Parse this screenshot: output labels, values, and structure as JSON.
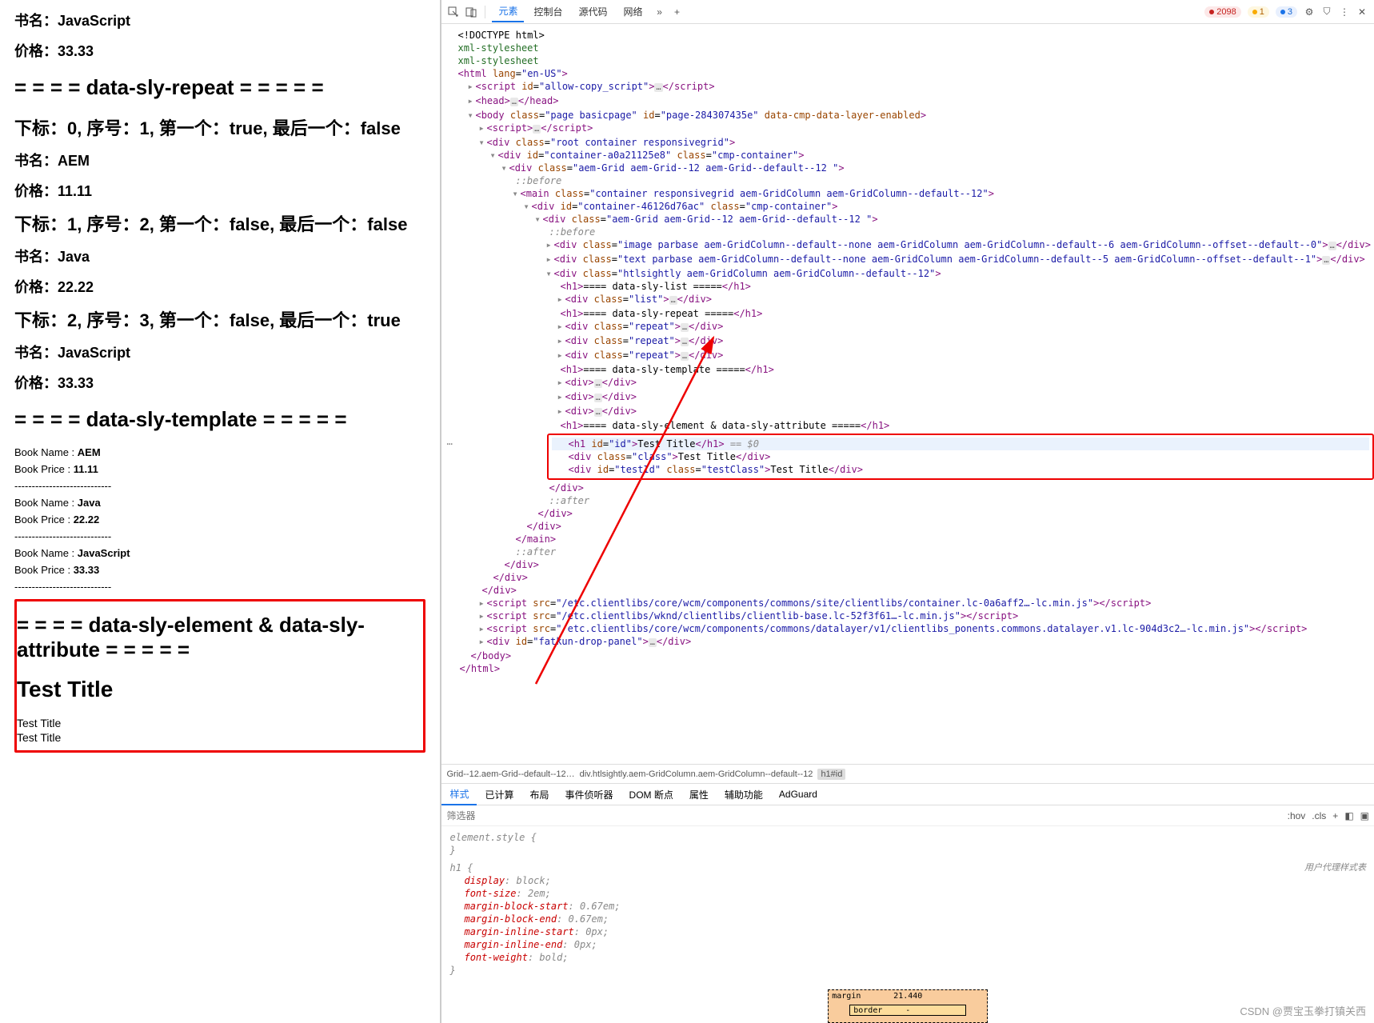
{
  "content": {
    "book1": {
      "name_label": "书名：",
      "name": "JavaScript",
      "price_label": "价格：",
      "price": "33.33"
    },
    "sec_repeat": "= = = = data-sly-repeat = = = = =",
    "rep": [
      {
        "stat": "下标：0, 序号：1, 第一个：true, 最后一个：false",
        "name": "AEM",
        "price": "11.11"
      },
      {
        "stat": "下标：1, 序号：2, 第一个：false, 最后一个：false",
        "name": "Java",
        "price": "22.22"
      },
      {
        "stat": "下标：2, 序号：3, 第一个：false, 最后一个：true",
        "name": "JavaScript",
        "price": "33.33"
      }
    ],
    "name_label": "书名：",
    "price_label": "价格：",
    "sec_template": "= = = = data-sly-template = = = = =",
    "tmpl_name_label": "Book Name : ",
    "tmpl_price_label": "Book Price : ",
    "tmpl": [
      {
        "name": "AEM",
        "price": "11.11"
      },
      {
        "name": "Java",
        "price": "22.22"
      },
      {
        "name": "JavaScript",
        "price": "33.33"
      }
    ],
    "dashes": "----------------------------",
    "sec_attr": "= = = = data-sly-element & data-sly-attribute = = = = =",
    "test_title": "Test Title",
    "tt1": "Test Title",
    "tt2": "Test Title"
  },
  "devtools": {
    "tabs": [
      "元素",
      "控制台",
      "源代码",
      "网络"
    ],
    "badges": {
      "err": "2098",
      "warn": "1",
      "info": "3"
    },
    "crumb": [
      "Grid--12.aem-Grid--default--12…",
      "div.htlsightly.aem-GridColumn.aem-GridColumn--default--12",
      "h1#id"
    ],
    "styles_tabs": [
      "样式",
      "已计算",
      "布局",
      "事件侦听器",
      "DOM 断点",
      "属性",
      "辅助功能",
      "AdGuard"
    ],
    "filter_placeholder": "筛选器",
    "hov": ":hov",
    "cls": ".cls",
    "elem_style": "element.style {",
    "brace": "}",
    "h1_sel": "h1 {",
    "ua_label": "用户代理样式表",
    "rules": [
      {
        "p": "display",
        "v": "block"
      },
      {
        "p": "font-size",
        "v": "2em"
      },
      {
        "p": "margin-block-start",
        "v": "0.67em"
      },
      {
        "p": "margin-block-end",
        "v": "0.67em"
      },
      {
        "p": "margin-inline-start",
        "v": "0px"
      },
      {
        "p": "margin-inline-end",
        "v": "0px"
      },
      {
        "p": "font-weight",
        "v": "bold"
      }
    ],
    "boxmodel": {
      "margin_label": "margin",
      "margin_top": "21.440",
      "border_label": "border",
      "border_dash": "-"
    },
    "tree": {
      "doctype": "<!DOCTYPE html>",
      "xml": "xml-stylesheet",
      "html": "<html lang=\"en-US\">",
      "script_allow": "<script id=\"allow-copy_script\">…</script>",
      "head": "<head>…</head>",
      "body": "<body class=\"page basicpage\" id=\"page-284307435e\" data-cmp-data-layer-enabled>",
      "body_script": "<script>…</script>",
      "root": "<div class=\"root container responsivegrid\">",
      "container1": "<div id=\"container-a0a21125e8\" class=\"cmp-container\">",
      "grid1": "<div class=\"aem-Grid aem-Grid--12 aem-Grid--default--12 \">",
      "before": "::before",
      "main": "<main class=\"container responsivegrid aem-GridColumn aem-GridColumn--default--12\">",
      "container2": "<div id=\"container-46126d76ac\" class=\"cmp-container\">",
      "grid2": "<div class=\"aem-Grid aem-Grid--12 aem-Grid--default--12 \">",
      "image": "<div class=\"image parbase aem-GridColumn--default--none aem-GridColumn aem-GridColumn--default--6 aem-GridColumn--offset--default--0\">…</div>",
      "text": "<div class=\"text parbase aem-GridColumn--default--none aem-GridColumn aem-GridColumn--default--5 aem-GridColumn--offset--default--1\">…</div>",
      "htl": "<div class=\"htlsightly aem-GridColumn aem-GridColumn--default--12\">",
      "h1_list": "<h1>==== data-sly-list =====</h1>",
      "div_list": "<div class=\"list\">…</div>",
      "h1_repeat": "<h1>==== data-sly-repeat =====</h1>",
      "div_repeat1": "<div class=\"repeat\">…</div>",
      "div_repeat2": "<div class=\"repeat\">…</div>",
      "div_repeat3": "<div class=\"repeat\">…</div>",
      "h1_template": "<h1>==== data-sly-template =====</h1>",
      "div_e1": "<div>…</div>",
      "div_e2": "<div>…</div>",
      "div_e3": "<div>…</div>",
      "h1_attr": "<h1>==== data-sly-element & data-sly-attribute =====</h1>",
      "sel_h1": "<h1 id=\"id\">Test Title</h1>",
      "sel_eq": " == $0",
      "sel_div1": "<div class=\"class\">Test Title</div>",
      "sel_div2": "<div id=\"testId\" class=\"testClass\">Test Title</div>",
      "close_div": "</div>",
      "after": "::after",
      "close_main": "</main>",
      "clientlib1": "<script src=\"/etc.clientlibs/core/wcm/components/commons/site/clientlibs/container.lc-0a6aff2…-lc.min.js\"></script>",
      "clientlib2": "<script src=\"/etc.clientlibs/wknd/clientlibs/clientlib-base.lc-52f3f61…-lc.min.js\"></script>",
      "clientlib3": "<script src=\"/etc.clientlibs/core/wcm/components/commons/datalayer/v1/clientlibs_ponents.commons.datalayer.v1.lc-904d3c2…-lc.min.js\"></script>",
      "fatkun": "<div id=\"fatkun-drop-panel\">…</div>",
      "close_body": "</body>",
      "close_html": "</html>"
    }
  },
  "watermark": "CSDN @贾宝玉拳打镇关西"
}
